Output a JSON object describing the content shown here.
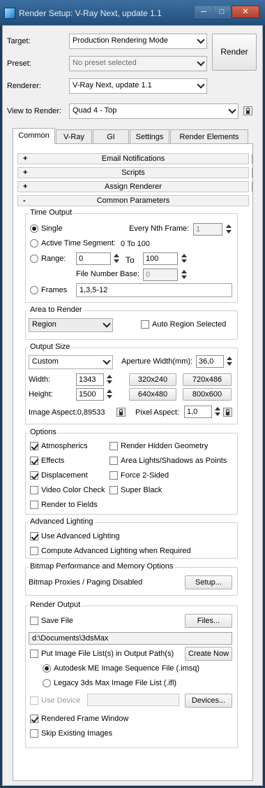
{
  "window": {
    "title": "Render Setup: V-Ray Next, update 1.1",
    "minimize": "─",
    "maximize": "□",
    "close": "✕"
  },
  "header": {
    "target_label": "Target:",
    "target_value": "Production Rendering Mode",
    "preset_label": "Preset:",
    "preset_value": "No preset selected",
    "renderer_label": "Renderer:",
    "renderer_value": "V-Ray Next, update 1.1",
    "view_label": "View to Render:",
    "view_value": "Quad 4 - Top",
    "render_button": "Render"
  },
  "tabs": [
    "Common",
    "V-Ray",
    "GI",
    "Settings",
    "Render Elements"
  ],
  "rollouts": {
    "email": {
      "sign": "+",
      "label": "Email Notifications"
    },
    "scripts": {
      "sign": "+",
      "label": "Scripts"
    },
    "assign": {
      "sign": "+",
      "label": "Assign Renderer"
    },
    "common": {
      "sign": "-",
      "label": "Common Parameters"
    }
  },
  "time_output": {
    "title": "Time Output",
    "single": "Single",
    "every_nth_label": "Every Nth Frame:",
    "every_nth_value": "1",
    "active_segment": "Active Time Segment:",
    "active_range": "0 To 100",
    "range": "Range:",
    "range_from": "0",
    "range_to_label": "To",
    "range_to": "100",
    "file_number_base_label": "File Number Base:",
    "file_number_base": "0",
    "frames": "Frames",
    "frames_value": "1,3,5-12"
  },
  "area_to_render": {
    "title": "Area to Render",
    "value": "Region",
    "auto_region": "Auto Region Selected"
  },
  "output_size": {
    "title": "Output Size",
    "preset": "Custom",
    "aperture_label": "Aperture Width(mm):",
    "aperture_value": "36,0",
    "width_label": "Width:",
    "width_value": "1343",
    "height_label": "Height:",
    "height_value": "1500",
    "btn_320": "320x240",
    "btn_720": "720x486",
    "btn_640": "640x480",
    "btn_800": "800x600",
    "image_aspect": "Image Aspect:0,89533",
    "pixel_aspect_label": "Pixel Aspect:",
    "pixel_aspect_value": "1,0"
  },
  "options": {
    "title": "Options",
    "atmospherics": "Atmospherics",
    "effects": "Effects",
    "displacement": "Displacement",
    "video_color_check": "Video Color Check",
    "render_to_fields": "Render to Fields",
    "render_hidden": "Render Hidden Geometry",
    "area_lights": "Area Lights/Shadows as Points",
    "force_2sided": "Force 2-Sided",
    "super_black": "Super Black"
  },
  "advanced_lighting": {
    "title": "Advanced Lighting",
    "use": "Use Advanced Lighting",
    "compute": "Compute Advanced Lighting when Required"
  },
  "bitmap": {
    "title": "Bitmap Performance and Memory Options",
    "status": "Bitmap Proxies / Paging Disabled",
    "setup": "Setup..."
  },
  "render_output": {
    "title": "Render Output",
    "save_file": "Save File",
    "files": "Files...",
    "path": "d:\\Documents\\3dsMax",
    "put_image": "Put Image File List(s) in Output Path(s)",
    "create_now": "Create Now",
    "autodesk_me": "Autodesk ME Image Sequence File (.imsq)",
    "legacy": "Legacy 3ds Max Image File List (.ifl)",
    "use_device": "Use Device",
    "devices": "Devices...",
    "rendered_frame_window": "Rendered Frame Window",
    "skip_existing": "Skip Existing Images"
  }
}
